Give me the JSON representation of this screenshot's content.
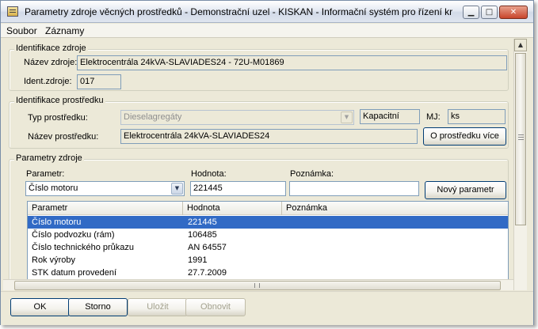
{
  "window": {
    "title": "Parametry zdroje věcných prostředků - Demonstrační uzel - KISKAN - Informační systém pro řízení kr...",
    "minimize_glyph": "▁",
    "maximize_glyph": "□",
    "close_glyph": "✕"
  },
  "menu": [
    "Soubor",
    "Záznamy"
  ],
  "identifikace_zdroje": {
    "title": "Identifikace zdroje",
    "nazev_label": "Název zdroje:",
    "nazev_value": "Elektrocentrála 24kVA-SLAVIADES24 - 72U-M01869",
    "ident_label": "Ident.zdroje:",
    "ident_value": "017"
  },
  "identifikace_prostredku": {
    "title": "Identifikace prostředku",
    "typ_label": "Typ prostředku:",
    "typ_value": "Dieselagregáty",
    "kapacitni": "Kapacitní",
    "mj_label": "MJ:",
    "mj_value": "ks",
    "nazev_label": "Název prostředku:",
    "nazev_value": "Elektrocentrála 24kVA-SLAVIADES24",
    "vice_button": "O prostředku více"
  },
  "parametry_zdroje": {
    "title": "Parametry zdroje",
    "parametr_label": "Parametr:",
    "parametr_value": "Číslo motoru",
    "hodnota_label": "Hodnota:",
    "hodnota_value": "221445",
    "poznamka_label": "Poznámka:",
    "poznamka_value": "",
    "novy_button": "Nový parametr",
    "columns": [
      "Parametr",
      "Hodnota",
      "Poznámka"
    ],
    "rows": [
      {
        "parametr": "Číslo motoru",
        "hodnota": "221445",
        "poznamka": ""
      },
      {
        "parametr": "Číslo podvozku (rám)",
        "hodnota": "106485",
        "poznamka": ""
      },
      {
        "parametr": "Číslo technického průkazu",
        "hodnota": "AN 64557",
        "poznamka": ""
      },
      {
        "parametr": "Rok výroby",
        "hodnota": "1991",
        "poznamka": ""
      },
      {
        "parametr": "STK datum provedení",
        "hodnota": "27.7.2009",
        "poznamka": ""
      }
    ],
    "selected_row": 0
  },
  "buttons": {
    "ok": "OK",
    "storno": "Storno",
    "ulozit": "Uložit",
    "obnovit": "Obnovit"
  },
  "icons": {
    "dropdown": "▼",
    "scroll_up": "▲",
    "scroll_down": "▼",
    "scroll_left": "◀",
    "scroll_right": "▶"
  }
}
